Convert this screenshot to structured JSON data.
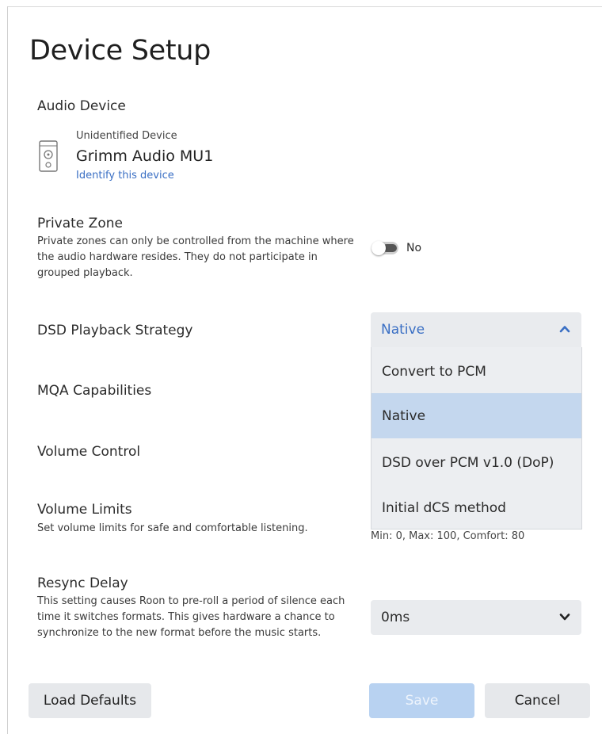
{
  "dialog": {
    "title": "Device Setup"
  },
  "audio_device": {
    "label": "Audio Device",
    "status": "Unidentified Device",
    "name": "Grimm Audio MU1",
    "identify_link": "Identify this device",
    "icon": "speaker-icon"
  },
  "private_zone": {
    "label": "Private Zone",
    "description": "Private zones can only be controlled from the machine where the audio hardware resides. They do not participate in grouped playback.",
    "toggle_value": "No",
    "toggle_on": false
  },
  "dsd_playback": {
    "label": "DSD Playback Strategy",
    "selected": "Native",
    "options": [
      "Convert to PCM",
      "Native",
      "DSD over PCM v1.0 (DoP)",
      "Initial dCS method"
    ],
    "expanded": true
  },
  "mqa": {
    "label": "MQA Capabilities"
  },
  "volume_control": {
    "label": "Volume Control"
  },
  "volume_limits": {
    "label": "Volume Limits",
    "description": "Set volume limits for safe and comfortable listening.",
    "summary": "Min: 0, Max: 100, Comfort: 80"
  },
  "resync_delay": {
    "label": "Resync Delay",
    "description": "This setting causes Roon to pre-roll a period of silence each time it switches formats. This gives hardware a chance to synchronize to the new format before the music starts.",
    "selected": "0ms"
  },
  "footer": {
    "load_defaults": "Load Defaults",
    "save": "Save",
    "cancel": "Cancel"
  },
  "colors": {
    "accent": "#3a6fc4",
    "selected_option": "#c4d7ee",
    "save_disabled": "#b8d2f1"
  }
}
